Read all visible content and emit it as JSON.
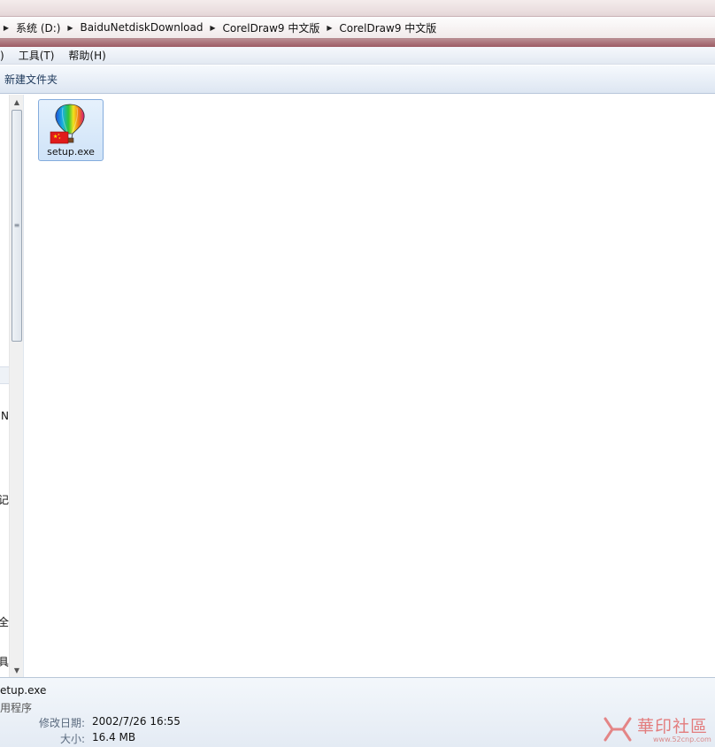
{
  "address_bar": {
    "crumbs": [
      "系统 (D:)",
      "BaiduNetdiskDownload",
      "CorelDraw9 中文版",
      "CorelDraw9 中文版"
    ]
  },
  "menubar": {
    "items": [
      ")",
      "工具(T)",
      "帮助(H)"
    ]
  },
  "toolbar": {
    "new_folder": "新建文件夹"
  },
  "navpane": {
    "fragments": [
      "N",
      "记",
      "全",
      "具"
    ]
  },
  "content": {
    "files": [
      {
        "name": "setup.exe",
        "icon": "balloon-installer-icon",
        "selected": true
      }
    ]
  },
  "details": {
    "name": "etup.exe",
    "type": "用程序",
    "modified_label": "修改日期:",
    "modified_value": "2002/7/26 16:55",
    "size_label": "大小:",
    "size_value": "16.4 MB"
  },
  "watermark": {
    "text": "華印社區",
    "url": "www.52cnp.com"
  },
  "colors": {
    "selection_border": "#84acdd",
    "selection_fill": "#cfe3f8",
    "titlebar": "#9c5c64"
  }
}
